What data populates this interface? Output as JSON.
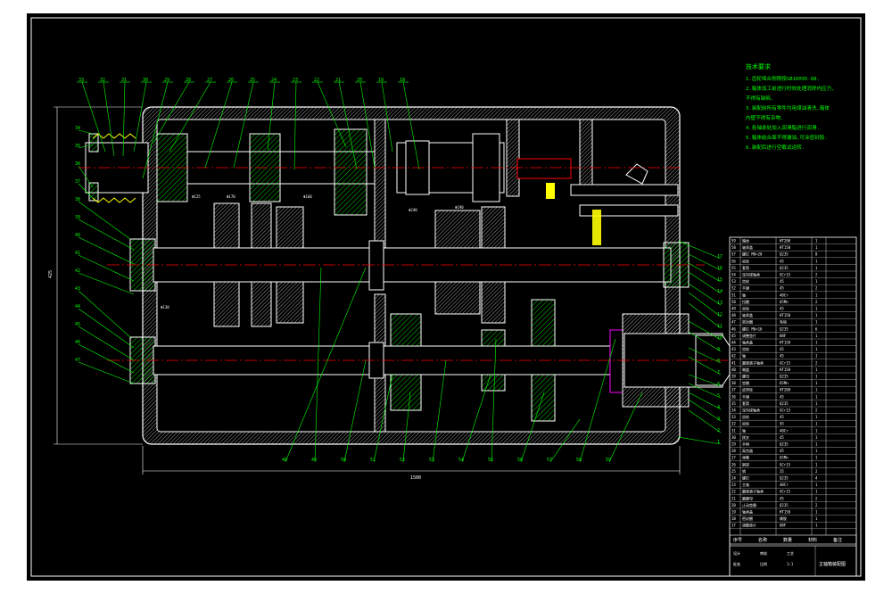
{
  "drawing": {
    "notes_title": "技术要求",
    "notes": [
      "1.齿轮啮合侧隙按GB10095-88.",
      "2.箱体加工前进行时效处理消除内应力,",
      "   不得有缺陷.",
      "3.装配前所有零件均用煤油清洗,箱体",
      "   内壁不得有杂物.",
      "4.各轴承处加入润滑脂进行润滑.",
      "5.箱体结合面不得漏油,可涂密封胶.",
      "6.装配后进行空载试运转."
    ],
    "overall_width_label": "1500",
    "overall_height_label": "425",
    "title_block_name": "主轴箱装配图",
    "callouts_top": [
      "33",
      "32",
      "31",
      "30",
      "29",
      "28",
      "27",
      "26",
      "25",
      "24",
      "23",
      "22",
      "21",
      "20",
      "19",
      "18"
    ],
    "callouts_left": [
      "34",
      "35",
      "36",
      "37",
      "38",
      "39",
      "40",
      "41",
      "42",
      "43",
      "44",
      "45",
      "46",
      "47"
    ],
    "callouts_right": [
      "1",
      "2",
      "3",
      "4",
      "5",
      "6",
      "7",
      "8",
      "9",
      "10",
      "11",
      "12",
      "13",
      "14",
      "15",
      "16",
      "17"
    ],
    "callouts_bottom": [
      "48",
      "49",
      "50",
      "51",
      "52",
      "53",
      "54",
      "55",
      "56",
      "57",
      "58",
      "59"
    ],
    "gear_labels": [
      "Φ125",
      "Φ170",
      "Φ160",
      "Φ240",
      "Φ190",
      "Φ130"
    ]
  },
  "bom": {
    "rows": [
      {
        "no": "59",
        "name": "箱体",
        "qty": "1",
        "mat": "HT200"
      },
      {
        "no": "58",
        "name": "轴承盖",
        "qty": "1",
        "mat": "HT150"
      },
      {
        "no": "57",
        "name": "螺钉 M8×20",
        "qty": "8",
        "mat": "Q235"
      },
      {
        "no": "56",
        "name": "齿轮",
        "qty": "1",
        "mat": "45"
      },
      {
        "no": "55",
        "name": "套筒",
        "qty": "1",
        "mat": "Q235"
      },
      {
        "no": "54",
        "name": "深沟球轴承",
        "qty": "2",
        "mat": "GCr15"
      },
      {
        "no": "53",
        "name": "齿轮",
        "qty": "1",
        "mat": "45"
      },
      {
        "no": "52",
        "name": "平键",
        "qty": "2",
        "mat": "45"
      },
      {
        "no": "51",
        "name": "轴",
        "qty": "1",
        "mat": "40Cr"
      },
      {
        "no": "50",
        "name": "挡圈",
        "qty": "2",
        "mat": "65Mn"
      },
      {
        "no": "49",
        "name": "齿轮",
        "qty": "1",
        "mat": "45"
      },
      {
        "no": "48",
        "name": "轴承盖",
        "qty": "1",
        "mat": "HT150"
      },
      {
        "no": "47",
        "name": "密封圈",
        "qty": "1",
        "mat": "毛毡"
      },
      {
        "no": "46",
        "name": "螺钉 M6×16",
        "qty": "6",
        "mat": "Q235"
      },
      {
        "no": "45",
        "name": "调整垫片",
        "qty": "1",
        "mat": "08F"
      },
      {
        "no": "44",
        "name": "轴承盖",
        "qty": "1",
        "mat": "HT150"
      },
      {
        "no": "43",
        "name": "齿轮",
        "qty": "1",
        "mat": "45"
      },
      {
        "no": "42",
        "name": "轴",
        "qty": "1",
        "mat": "45"
      },
      {
        "no": "41",
        "name": "圆锥滚子轴承",
        "qty": "2",
        "mat": "GCr15"
      },
      {
        "no": "40",
        "name": "端盖",
        "qty": "1",
        "mat": "HT150"
      },
      {
        "no": "39",
        "name": "螺母",
        "qty": "1",
        "mat": "Q235"
      },
      {
        "no": "38",
        "name": "垫圈",
        "qty": "1",
        "mat": "65Mn"
      },
      {
        "no": "37",
        "name": "皮带轮",
        "qty": "1",
        "mat": "HT200"
      },
      {
        "no": "36",
        "name": "平键",
        "qty": "1",
        "mat": "45"
      },
      {
        "no": "35",
        "name": "套筒",
        "qty": "1",
        "mat": "Q235"
      },
      {
        "no": "34",
        "name": "深沟球轴承",
        "qty": "2",
        "mat": "GCr15"
      },
      {
        "no": "33",
        "name": "齿轮",
        "qty": "1",
        "mat": "45"
      },
      {
        "no": "32",
        "name": "齿轮",
        "qty": "1",
        "mat": "45"
      },
      {
        "no": "31",
        "name": "轴",
        "qty": "1",
        "mat": "40Cr"
      },
      {
        "no": "30",
        "name": "拨叉",
        "qty": "1",
        "mat": "45"
      },
      {
        "no": "29",
        "name": "手柄",
        "qty": "1",
        "mat": "Q235"
      },
      {
        "no": "28",
        "name": "离合器",
        "qty": "1",
        "mat": "45"
      },
      {
        "no": "27",
        "name": "弹簧",
        "qty": "1",
        "mat": "65Mn"
      },
      {
        "no": "26",
        "name": "钢球",
        "qty": "1",
        "mat": "GCr15"
      },
      {
        "no": "25",
        "name": "销",
        "qty": "2",
        "mat": "35"
      },
      {
        "no": "24",
        "name": "螺钉",
        "qty": "4",
        "mat": "Q235"
      },
      {
        "no": "23",
        "name": "主轴",
        "qty": "1",
        "mat": "40Cr"
      },
      {
        "no": "22",
        "name": "圆锥滚子轴承",
        "qty": "1",
        "mat": "GCr15"
      },
      {
        "no": "21",
        "name": "圆螺母",
        "qty": "2",
        "mat": "45"
      },
      {
        "no": "20",
        "name": "止动垫圈",
        "qty": "2",
        "mat": "Q235"
      },
      {
        "no": "19",
        "name": "轴承盖",
        "qty": "1",
        "mat": "HT150"
      },
      {
        "no": "18",
        "name": "密封圈",
        "qty": "1",
        "mat": "橡胶"
      },
      {
        "no": "17",
        "name": "调整垫片",
        "qty": "1",
        "mat": "08F"
      }
    ],
    "header": [
      "序号",
      "名称",
      "数量",
      "材料",
      "备注"
    ],
    "footer_title": "主轴箱装配图",
    "footer_fields": [
      "设计",
      "审核",
      "工艺",
      "批准",
      "比例",
      "1:1"
    ]
  },
  "colors": {
    "background": "#000000",
    "outline": "#ffffff",
    "leader": "#00ff00",
    "centerline": "#ff0000",
    "hatch": "#00ff00",
    "part": "#ffff00",
    "bearing": "#ff00ff",
    "dim": "#ffffff"
  }
}
